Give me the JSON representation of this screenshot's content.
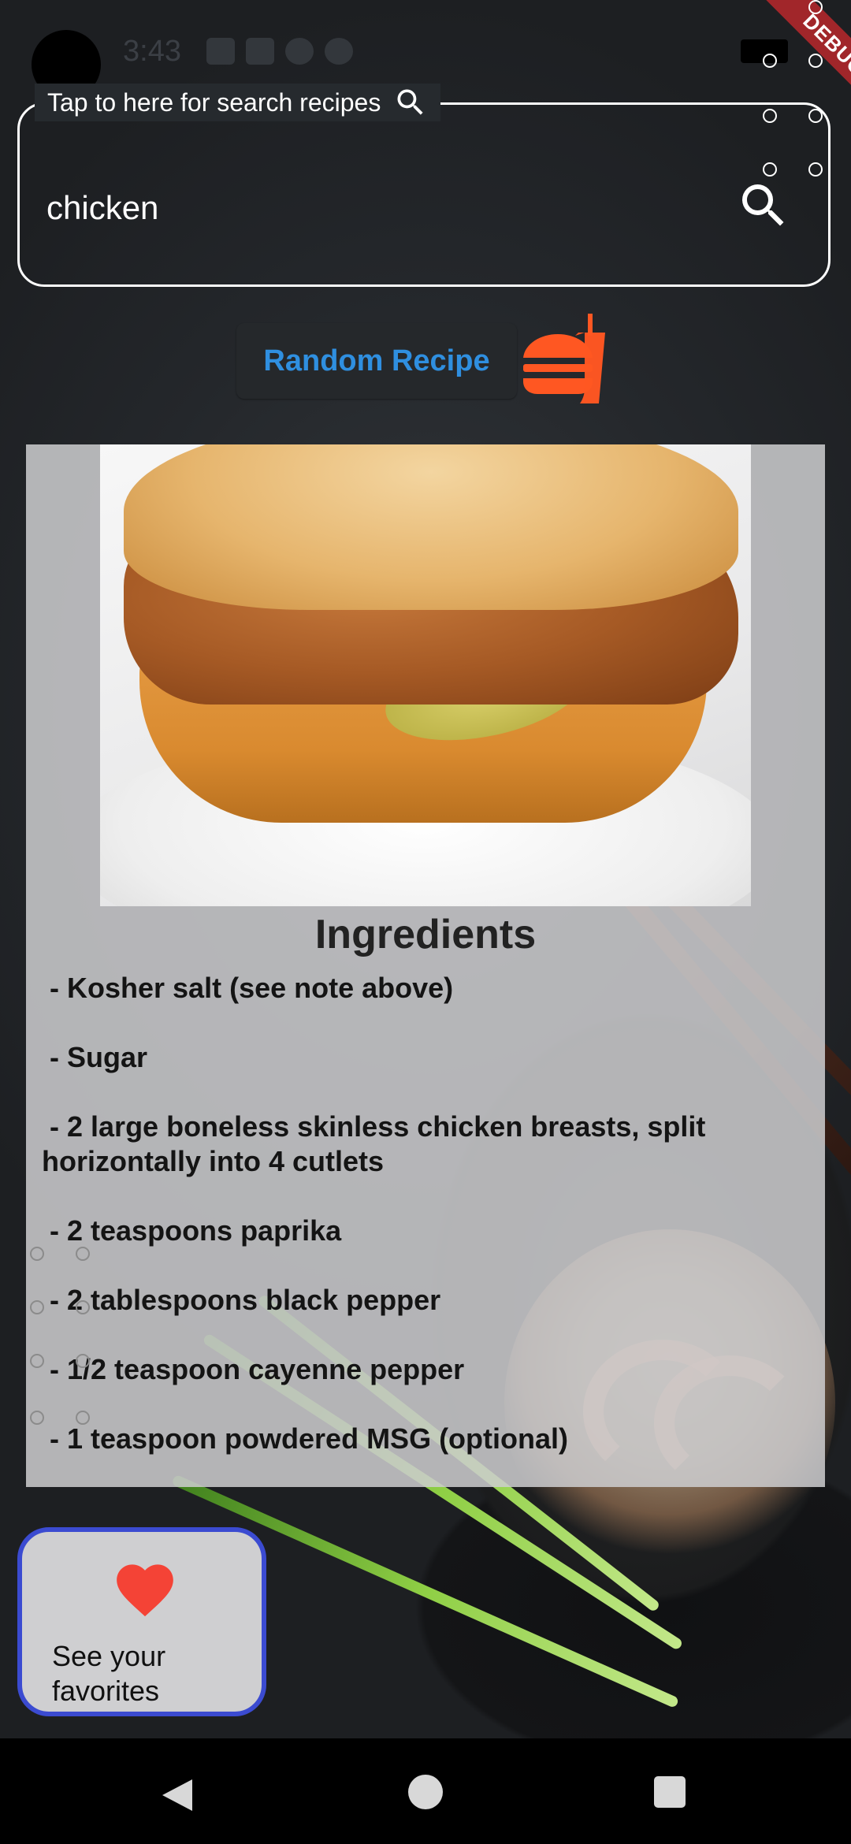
{
  "status_bar": {
    "time": "3:43"
  },
  "debug_banner": {
    "label": "DEBUG"
  },
  "search": {
    "hint": "Tap to here for search  recipes",
    "value": "chicken",
    "search_icon": "search-icon"
  },
  "random_recipe": {
    "label": "Random Recipe",
    "icon": "fastfood-icon"
  },
  "recipe": {
    "ingredients_title": "Ingredients",
    "ingredients": [
      " - Kosher salt (see note above)",
      " - Sugar",
      " - 2 large boneless skinless chicken breasts, split horizontally into 4 cutlets",
      " - 2 teaspoons paprika",
      " - 2 tablespoons black pepper",
      " - 1/2 teaspoon cayenne pepper",
      " - 1 teaspoon powdered MSG (optional)"
    ]
  },
  "favorites": {
    "label": "See your favorites",
    "icon": "heart-icon"
  },
  "colors": {
    "accent_blue": "#2f8fe0",
    "fastfood_orange": "#ff5722",
    "heart_red": "#f44336",
    "favorites_border": "#3b4bd1",
    "debug_red": "#a1262a"
  },
  "navigation": {
    "back": "back-icon",
    "home": "home-icon",
    "recents": "recents-icon"
  }
}
